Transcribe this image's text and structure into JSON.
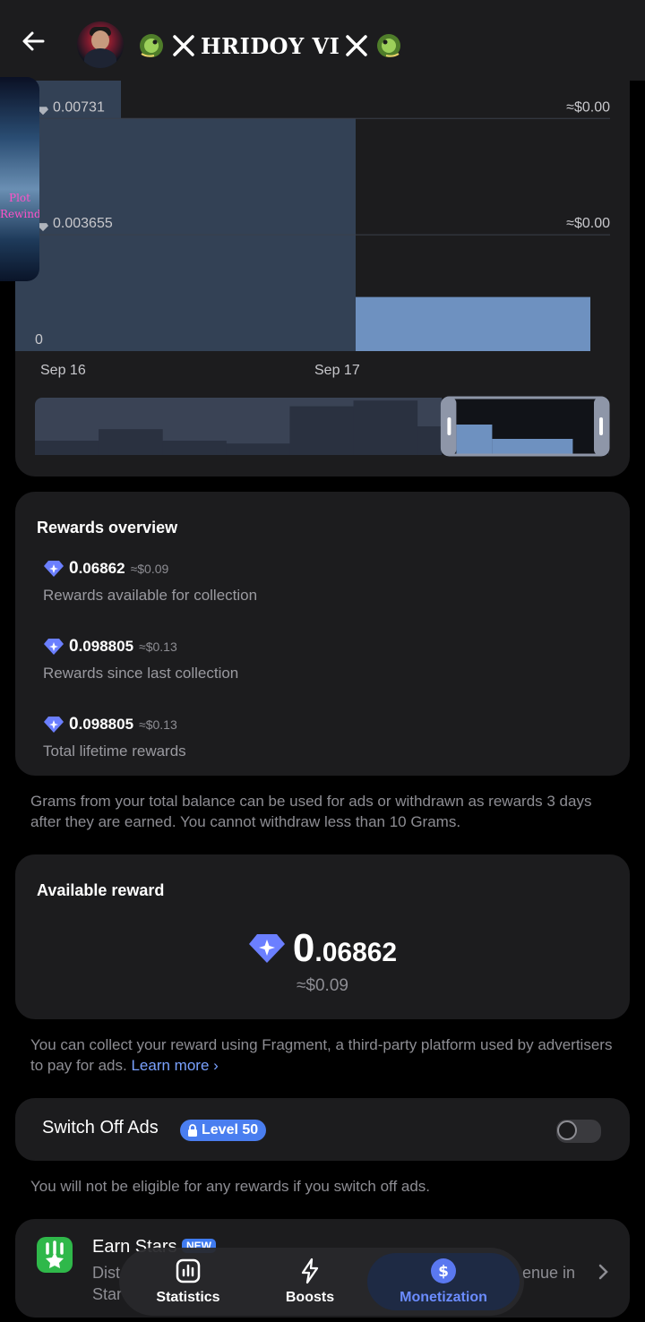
{
  "header": {
    "title": "HRIDOY VI",
    "back_icon": "arrow-left-icon"
  },
  "pip_overlay": {
    "text_line1": "Plot",
    "text_line2": "Rewind"
  },
  "chart_data": {
    "type": "bar",
    "x": [
      "Sep 16",
      "Sep 17"
    ],
    "y_ticks": [
      "0",
      "0.003655",
      "0.00731"
    ],
    "y_right_ticks": [
      "≈$0.00",
      "≈$0.00"
    ],
    "values": [
      0.0095,
      0.00731,
      0.0017
    ],
    "ylim": [
      0,
      0.0085
    ],
    "colors": {
      "background_bar": "#334155",
      "highlight_bar": "#6e91c0"
    },
    "navigator": {
      "values": [
        0.25,
        0.45,
        0.25,
        0.2,
        0.85,
        0.95,
        0.5,
        0.22,
        0.05
      ],
      "selection_start_fraction": 0.71,
      "selection_end_fraction": 1.0
    }
  },
  "rewards_overview": {
    "title": "Rewards overview",
    "items": [
      {
        "int": "0",
        "dec": ".06862",
        "usd": "≈$0.09",
        "label": "Rewards available for collection"
      },
      {
        "int": "0",
        "dec": ".098805",
        "usd": "≈$0.13",
        "label": "Rewards since last collection"
      },
      {
        "int": "0",
        "dec": ".098805",
        "usd": "≈$0.13",
        "label": "Total lifetime rewards"
      }
    ]
  },
  "grams_note": "Grams from your total balance can be used for ads or withdrawn as rewards 3 days after they are earned. You cannot withdraw less than 10 Grams.",
  "available_reward": {
    "title": "Available reward",
    "int": "0",
    "dec": ".06862",
    "usd": "≈$0.09"
  },
  "collect_note": {
    "text": "You can collect your reward using Fragment, a third-party platform used by advertisers to pay for ads.",
    "link": "Learn more",
    "link_chevron": "›"
  },
  "switch_off_ads": {
    "label": "Switch Off Ads",
    "badge": "Level 50",
    "enabled": false
  },
  "ads_note": "You will not be eligible for any rewards if you switch off ads.",
  "earn_stars": {
    "title": "Earn Stars",
    "badge": "NEW",
    "desc_line1": "Dist",
    "desc_line2": "Star",
    "desc_right": "enue in"
  },
  "tabs": [
    {
      "label": "Statistics",
      "icon": "bar-chart-icon",
      "active": false
    },
    {
      "label": "Boosts",
      "icon": "lightning-icon",
      "active": false
    },
    {
      "label": "Monetization",
      "icon": "dollar-circle-icon",
      "active": true
    }
  ],
  "colors": {
    "accent": "#6b8cff",
    "card_bg": "#1c1c1e",
    "muted_text": "#8d8d93",
    "gem": "#6b7fff",
    "earn_green": "#2fb84a"
  }
}
